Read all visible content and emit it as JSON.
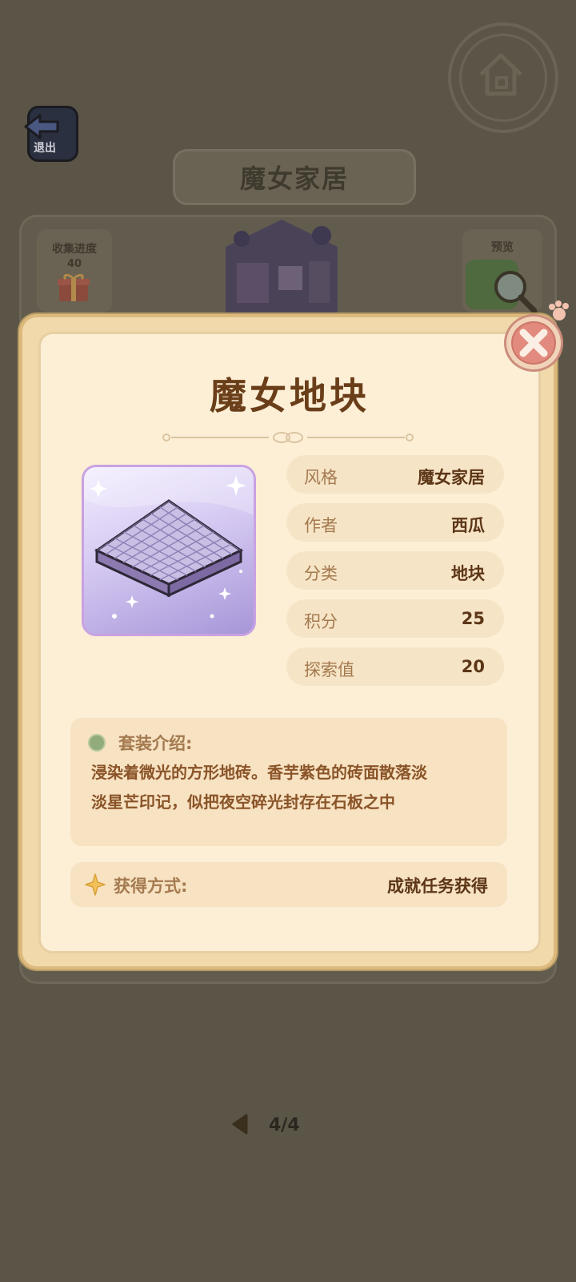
{
  "header": {
    "exit_label": "退出",
    "set_title": "魔女家居",
    "collect_label": "收集进度",
    "collect_value": "40",
    "preview_label": "预览"
  },
  "modal": {
    "title": "魔女地块",
    "attributes": [
      {
        "label": "风格",
        "value": "魔女家居"
      },
      {
        "label": "作者",
        "value": "西瓜"
      },
      {
        "label": "分类",
        "value": "地块"
      },
      {
        "label": "积分",
        "value": "25"
      },
      {
        "label": "探索值",
        "value": "20"
      }
    ],
    "description_label": "套装介绍:",
    "description_line1": "浸染着微光的方形地砖。香芋紫色的砖面散落淡",
    "description_line2": "淡星芒印记，似把夜空碎光封存在石板之中",
    "obtain_label": "获得方式:",
    "obtain_value": "成就任务获得"
  },
  "pager": {
    "text": "4/4"
  },
  "icons": [
    "home-icon",
    "exit-arrow-icon",
    "gift-icon",
    "magnifier-icon",
    "close-icon",
    "paw-icon",
    "sparkle-icon",
    "chevron-left-icon"
  ],
  "colors": {
    "overlay_bg": "#5a5547",
    "modal_bg": "#fcefd6",
    "title_brown": "#6a3e19",
    "close_red": "#e18a7d",
    "tile_purple": "#b9acd6"
  }
}
